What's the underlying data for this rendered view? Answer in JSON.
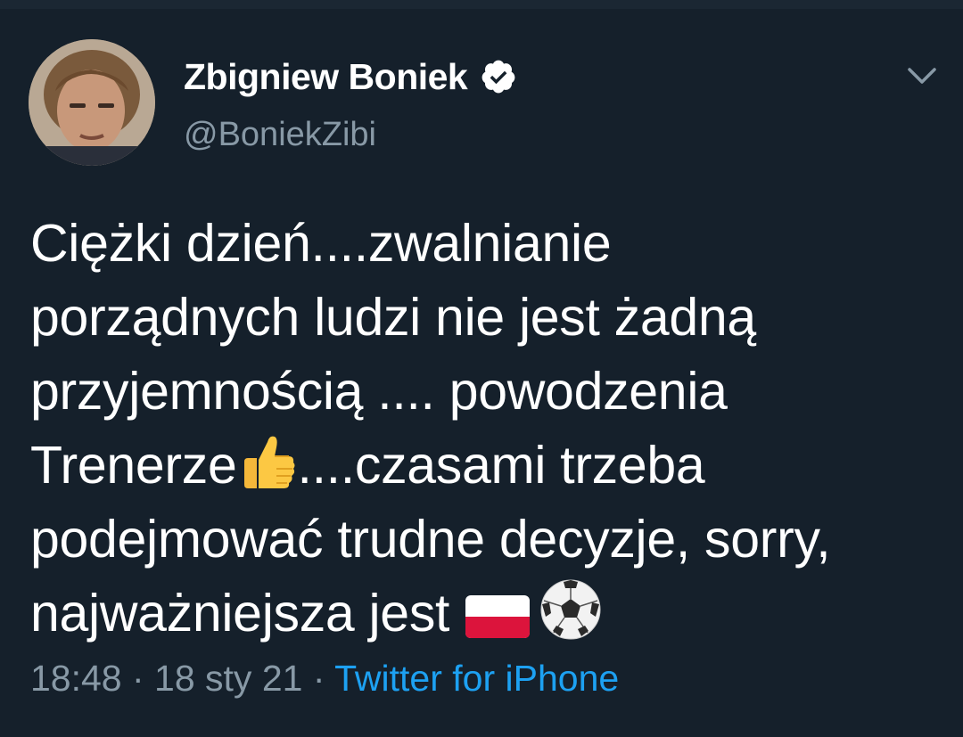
{
  "author": {
    "display_name": "Zbigniew Boniek",
    "handle": "@BoniekZibi",
    "verified": true
  },
  "tweet": {
    "lines": [
      "Ciężki dzień....zwalnianie",
      "porządnych ludzi nie jest żadną",
      "przyjemnością .... powodzenia",
      "Trenerze",
      "....czasami trzeba",
      "podejmować trudne decyzje, sorry,",
      "najważniejsza jest "
    ],
    "emojis": [
      "thumbs-up-icon",
      "poland-flag-icon",
      "soccer-ball-icon"
    ]
  },
  "meta": {
    "time": "18:48",
    "sep1": " · ",
    "date": "18 sty 21",
    "sep2": " · ",
    "source": "Twitter for iPhone"
  },
  "colors": {
    "background": "#15202b",
    "text": "#ffffff",
    "secondary": "#8899a6",
    "link": "#1da1f2"
  }
}
